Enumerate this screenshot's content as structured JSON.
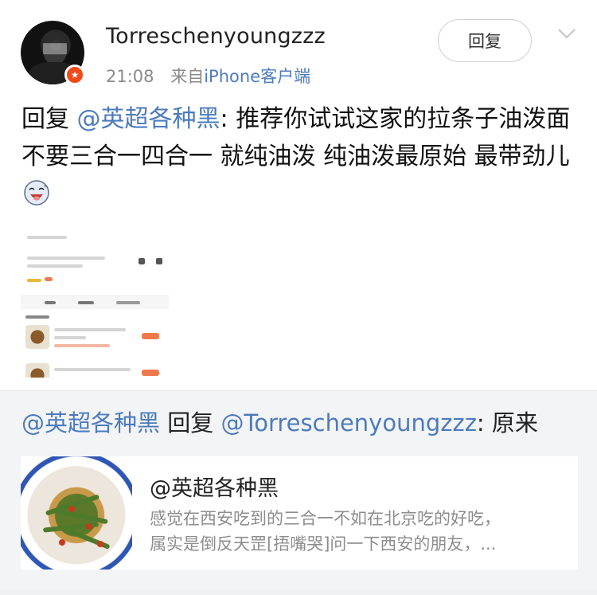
{
  "post": {
    "username": "Torreschenyoungzzz",
    "time": "21:08",
    "source_prefix": "来自",
    "source": "iPhone客户端",
    "reply_button": "回复",
    "content": {
      "prefix": "回复",
      "mention": "@英超各种黑",
      "text": ": 推荐你试试这家的拉条子油泼面 不要三合一四合一 就纯油泼 纯油泼最原始 最带劲儿"
    }
  },
  "repost": {
    "mention": "@英超各种黑",
    "middle": " 回复 ",
    "reply_mention": "@Torreschenyoungzzz",
    "text": ": 原来",
    "card": {
      "title": "@英超各种黑",
      "desc_line1": "感觉在西安吃到的三合一不如在北京吃的好吃，",
      "desc_line2": "属实是倒反天罡[捂嘴哭]问一下西安的朋友，..."
    }
  },
  "colors": {
    "link": "#4c7bbd",
    "badge": "#f24b1b",
    "repost_bg": "#f3f4f6"
  },
  "icons": [
    "verified-badge-icon",
    "chevron-down-icon",
    "laughing-emoji-icon"
  ]
}
